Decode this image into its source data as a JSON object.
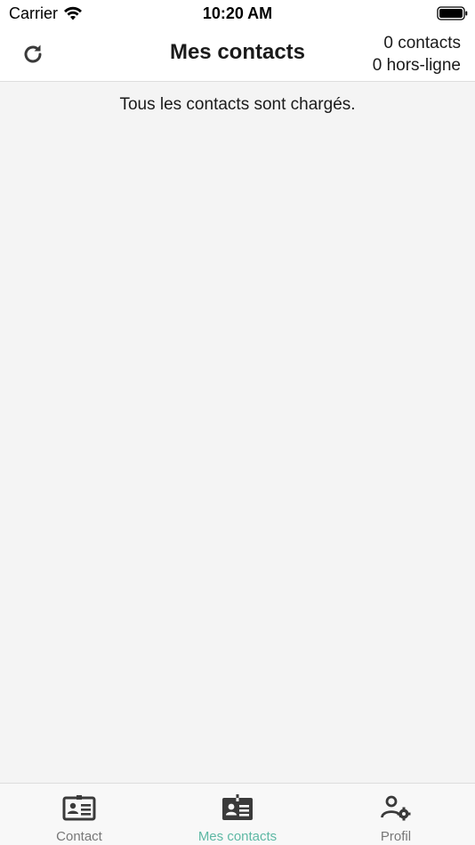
{
  "status_bar": {
    "carrier": "Carrier",
    "time": "10:20 AM",
    "icons": [
      "wifi-icon",
      "battery-icon"
    ]
  },
  "header": {
    "title": "Mes contacts",
    "contacts_count": "0 contacts",
    "offline_count": "0 hors-ligne",
    "refresh_icon": "refresh-icon"
  },
  "content": {
    "message": "Tous les contacts sont chargés."
  },
  "tab_bar": {
    "tabs": [
      {
        "label": "Contact",
        "icon": "contact-card-icon",
        "active": false
      },
      {
        "label": "Mes contacts",
        "icon": "contact-badge-icon",
        "active": true
      },
      {
        "label": "Profil",
        "icon": "user-settings-icon",
        "active": false
      }
    ]
  },
  "colors": {
    "accent": "#5db8a4",
    "icon": "#3a3a3a",
    "inactive_label": "#777777",
    "background": "#f4f4f4"
  }
}
